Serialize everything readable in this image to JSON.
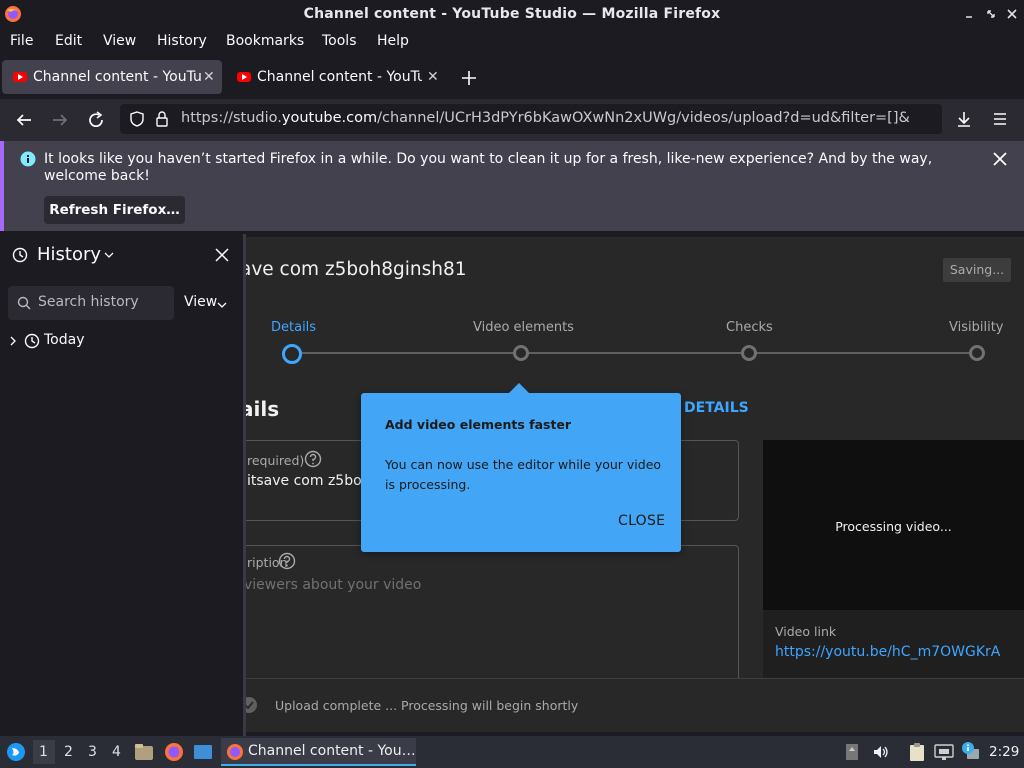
{
  "window": {
    "title": "Channel content - YouTube Studio — Mozilla Firefox"
  },
  "menu": [
    "File",
    "Edit",
    "View",
    "History",
    "Bookmarks",
    "Tools",
    "Help"
  ],
  "tabs": [
    {
      "label": "Channel content - YouTube Studio",
      "active": true
    },
    {
      "label": "Channel content - YouTube Studio",
      "active": false
    }
  ],
  "urlbar": {
    "prefix": "https://studio.",
    "domain": "youtube.com",
    "suffix": "/channel/UCrH3dPYr6bKawOXwNn2xUWg/videos/upload?d=ud&filter=[]&sort={\"columnType\":\"date\",\"sortOrder\":\"DESCENDING\"}"
  },
  "notification": {
    "message": "It looks like you haven’t started Firefox in a while. Do you want to clean it up for a fresh, like-new experience? And by the way, welcome back!",
    "button": "Refresh Firefox…"
  },
  "sidebar": {
    "title": "History",
    "search_placeholder": "Search history",
    "view_label": "View",
    "groups": [
      {
        "label": "Today"
      }
    ]
  },
  "studio": {
    "video_title": "ave com z5boh8ginsh81",
    "saving_label": "Saving...",
    "steps": [
      "Details",
      "Video elements",
      "Checks",
      "Visibility"
    ],
    "section_heading": "ails",
    "details_link": "DETAILS",
    "title_field": {
      "label": "required)",
      "value": "itsave com  z5boh"
    },
    "description_field": {
      "label": "ription",
      "placeholder": "viewers about your video"
    },
    "preview": {
      "processing": "Processing video...",
      "video_link_label": "Video link",
      "video_link": "https://youtu.be/hC_m7OWGKrA"
    },
    "footer_status": "Upload complete ... Processing will begin shortly"
  },
  "popup": {
    "title": "Add video elements faster",
    "body": "You can now use the editor while your video is processing.",
    "close": "CLOSE"
  },
  "taskbar": {
    "workspaces": [
      "1",
      "2",
      "3",
      "4"
    ],
    "task_label": "Channel content - You…",
    "clock": "2:29"
  },
  "colors": {
    "accent_blue": "#3ea6ff",
    "popup_blue": "#42a5f5",
    "notif_accent": "#a868fa",
    "youtube_red": "#ff0000"
  }
}
